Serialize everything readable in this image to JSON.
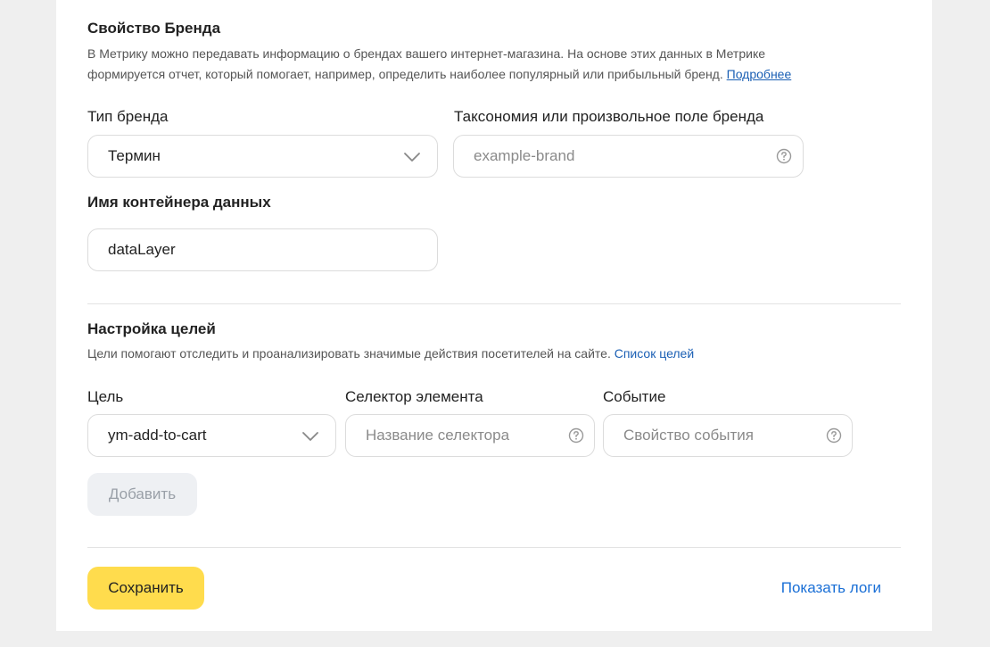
{
  "brand": {
    "title": "Свойство Бренда",
    "desc_line1": "В Метрику можно передавать информацию о брендах вашего интернет-магазина. На основе этих данных в Метрике",
    "desc_line2": "формируется отчет, который помогает, например, определить наиболее популярный или прибыльный бренд.",
    "more_link": "Подробнее",
    "type_label": "Тип бренда",
    "type_value": "Термин",
    "taxonomy_label": "Таксономия или произвольное поле бренда",
    "taxonomy_placeholder": "example-brand",
    "container_label": "Имя контейнера данных",
    "container_value": "dataLayer"
  },
  "goals": {
    "title": "Настройка целей",
    "desc": "Цели помогают отследить и проанализировать значимые действия посетителей на сайте.",
    "list_link": "Список целей",
    "goal_label": "Цель",
    "goal_value": "ym-add-to-cart",
    "selector_label": "Селектор элемента",
    "selector_placeholder": "Название селектора",
    "event_label": "Событие",
    "event_placeholder": "Свойство события",
    "add_button": "Добавить"
  },
  "footer": {
    "save_button": "Сохранить",
    "logs_link": "Показать логи"
  }
}
